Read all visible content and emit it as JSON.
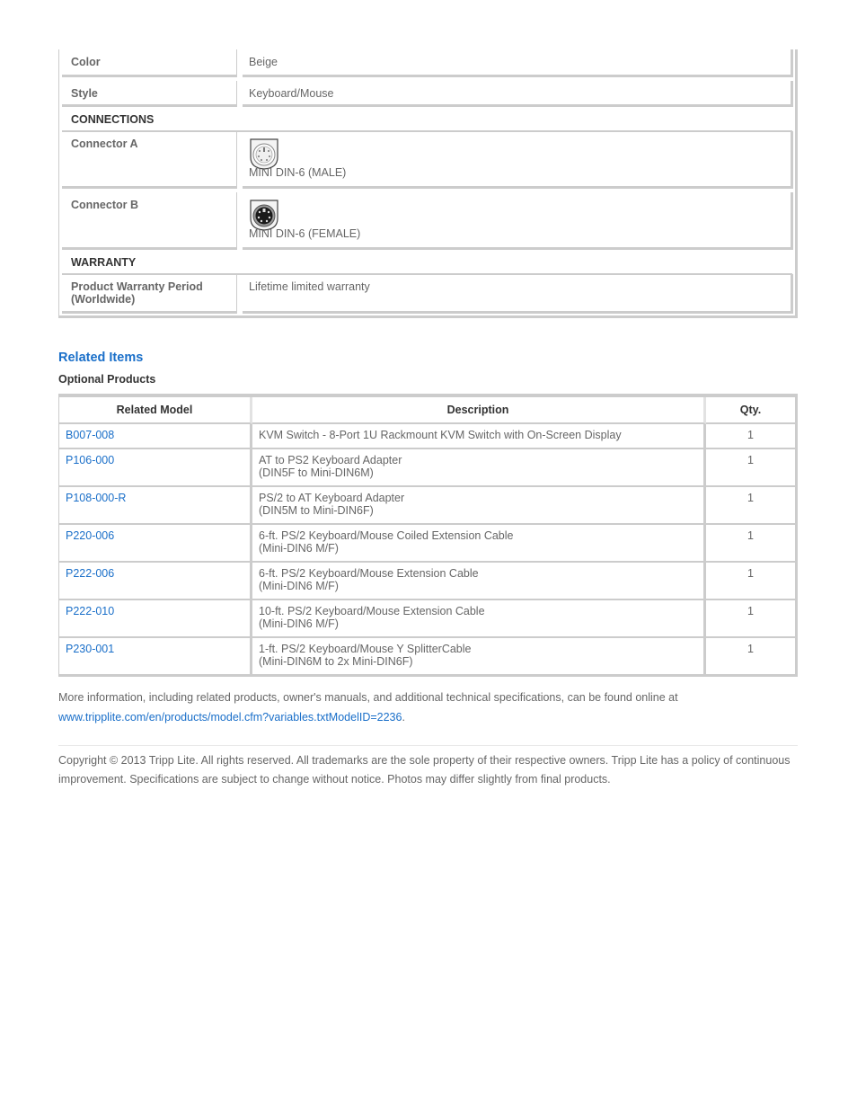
{
  "specs": {
    "rows_top": [
      {
        "label": "Color",
        "value": "Beige"
      },
      {
        "label": "Style",
        "value": "Keyboard/Mouse"
      }
    ],
    "connections": {
      "heading": "CONNECTIONS",
      "connector_a": {
        "label": "Connector A",
        "value": "MINI DIN-6 (MALE)",
        "icon": "mini-din-6-male-icon"
      },
      "connector_b": {
        "label": "Connector B",
        "value": "MINI DIN-6 (FEMALE)",
        "icon": "mini-din-6-female-icon"
      }
    },
    "warranty": {
      "heading": "WARRANTY",
      "period": {
        "label": "Product Warranty Period (Worldwide)",
        "value": "Lifetime limited warranty"
      }
    }
  },
  "related": {
    "title": "Related Items",
    "subtitle": "Optional Products",
    "headers": {
      "model": "Related Model",
      "description": "Description",
      "qty": "Qty."
    },
    "rows": [
      {
        "model": "B007-008",
        "desc1": "KVM Switch - 8-Port 1U Rackmount KVM Switch with On-Screen Display",
        "desc2": "",
        "qty": "1"
      },
      {
        "model": "P106-000",
        "desc1": "AT to PS2 Keyboard Adapter",
        "desc2": "(DIN5F to Mini-DIN6M)",
        "qty": "1"
      },
      {
        "model": "P108-000-R",
        "desc1": "PS/2 to AT Keyboard Adapter",
        "desc2": "(DIN5M to Mini-DIN6F)",
        "qty": "1"
      },
      {
        "model": "P220-006",
        "desc1": "6-ft. PS/2 Keyboard/Mouse Coiled Extension Cable",
        "desc2": "(Mini-DIN6 M/F)",
        "qty": "1"
      },
      {
        "model": "P222-006",
        "desc1": "6-ft. PS/2 Keyboard/Mouse Extension Cable",
        "desc2": "(Mini-DIN6 M/F)",
        "qty": "1"
      },
      {
        "model": "P222-010",
        "desc1": "10-ft. PS/2 Keyboard/Mouse Extension Cable",
        "desc2": "(Mini-DIN6 M/F)",
        "qty": "1"
      },
      {
        "model": "P230-001",
        "desc1": "1-ft. PS/2 Keyboard/Mouse Y SplitterCable",
        "desc2": "(Mini-DIN6M to 2x Mini-DIN6F)",
        "qty": "1"
      }
    ]
  },
  "footer": {
    "more_info": "More information, including related products, owner's manuals, and additional technical specifications, can be found online at",
    "link": "www.tripplite.com/en/products/model.cfm?variables.txtModelID=2236",
    "link_suffix": ".",
    "copyright": "Copyright © 2013 Tripp Lite. All rights reserved. All trademarks are the sole property of their respective owners. Tripp Lite has a policy of continuous improvement. Specifications are subject to change without notice. Photos may differ slightly from final products."
  }
}
